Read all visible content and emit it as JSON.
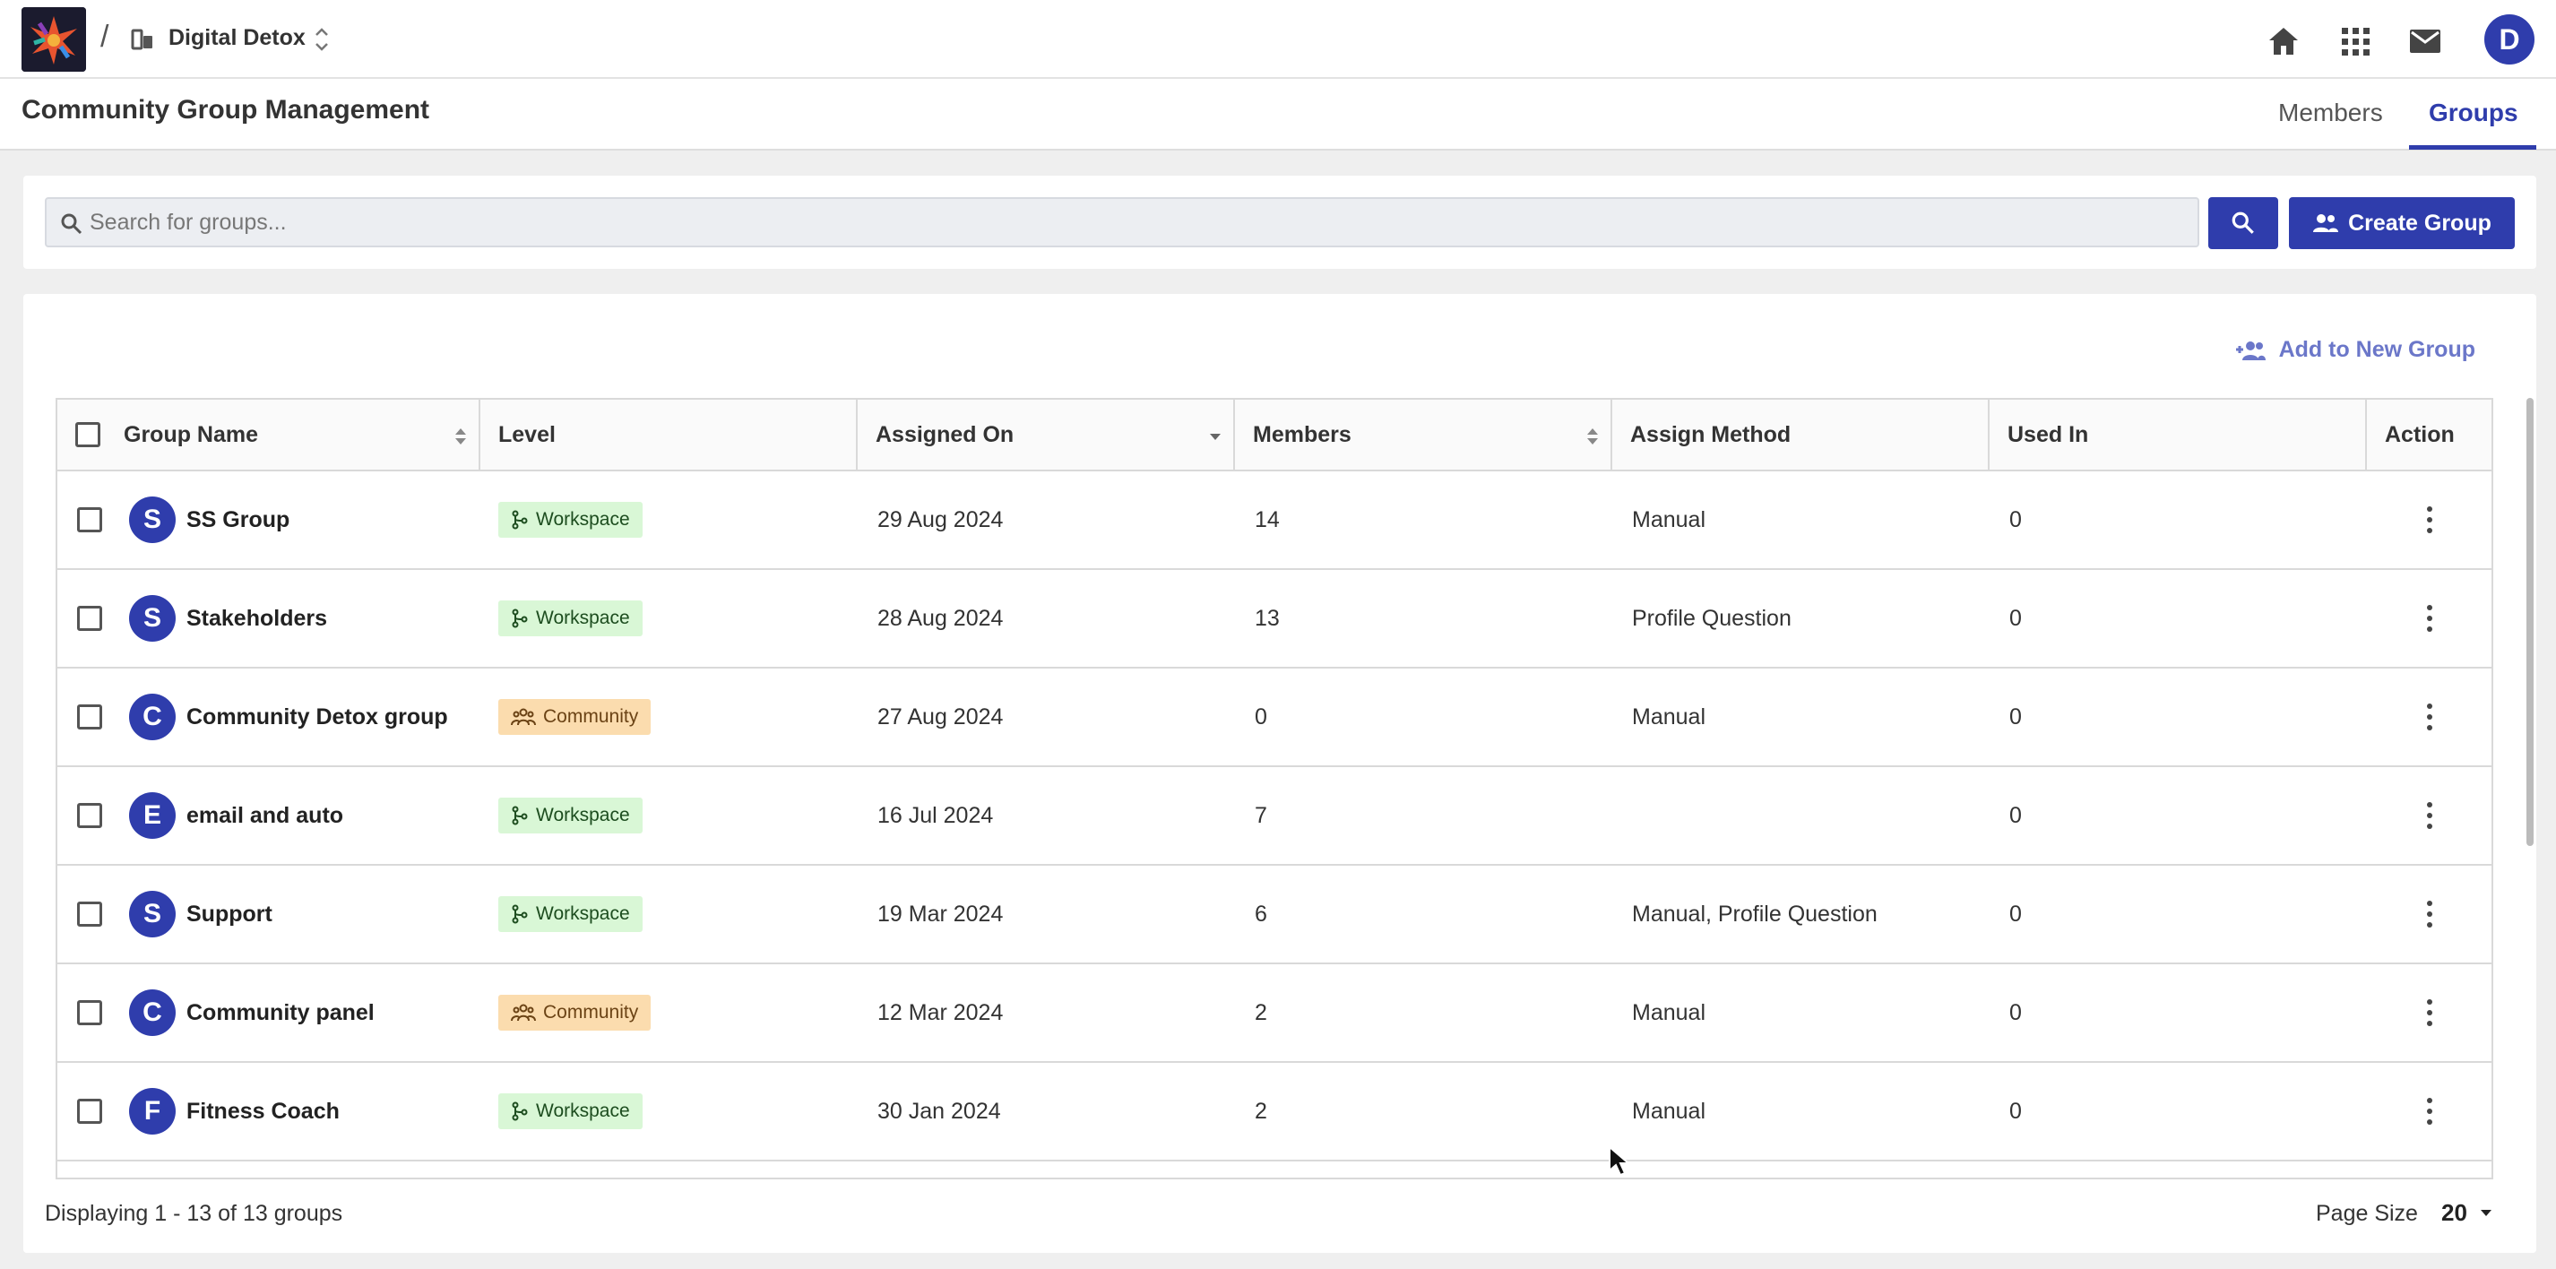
{
  "header": {
    "workspace_name": "Digital Detox",
    "avatar_initial": "D",
    "separator": "/"
  },
  "subheader": {
    "title": "Community Group Management",
    "tabs": [
      {
        "label": "Members",
        "active": false
      },
      {
        "label": "Groups",
        "active": true
      }
    ]
  },
  "search": {
    "placeholder": "Search for groups...",
    "value": "",
    "create_label": "Create Group"
  },
  "actions": {
    "add_to_new_group": "Add to New Group"
  },
  "table": {
    "columns": [
      "Group Name",
      "Level",
      "Assigned On",
      "Members",
      "Assign Method",
      "Used In",
      "Action"
    ],
    "rows": [
      {
        "initial": "S",
        "name": "SS Group",
        "level": "Workspace",
        "assigned_on": "29 Aug 2024",
        "members": "14",
        "method": "Manual",
        "used_in": "0"
      },
      {
        "initial": "S",
        "name": "Stakeholders",
        "level": "Workspace",
        "assigned_on": "28 Aug 2024",
        "members": "13",
        "method": "Profile Question",
        "used_in": "0"
      },
      {
        "initial": "C",
        "name": "Community Detox group",
        "level": "Community",
        "assigned_on": "27 Aug 2024",
        "members": "0",
        "method": "Manual",
        "used_in": "0"
      },
      {
        "initial": "E",
        "name": "email and auto",
        "level": "Workspace",
        "assigned_on": "16 Jul 2024",
        "members": "7",
        "method": "",
        "used_in": "0"
      },
      {
        "initial": "S",
        "name": "Support",
        "level": "Workspace",
        "assigned_on": "19 Mar 2024",
        "members": "6",
        "method": "Manual, Profile Question",
        "used_in": "0"
      },
      {
        "initial": "C",
        "name": "Community panel",
        "level": "Community",
        "assigned_on": "12 Mar 2024",
        "members": "2",
        "method": "Manual",
        "used_in": "0"
      },
      {
        "initial": "F",
        "name": "Fitness Coach",
        "level": "Workspace",
        "assigned_on": "30 Jan 2024",
        "members": "2",
        "method": "Manual",
        "used_in": "0"
      }
    ]
  },
  "footer": {
    "display_text": "Displaying 1 - 13 of 13 groups",
    "page_size_label": "Page Size",
    "page_size_value": "20"
  },
  "colors": {
    "primary": "#2f3dac",
    "workspace_badge": "#d9f7d6",
    "community_badge": "#fbdcae"
  }
}
